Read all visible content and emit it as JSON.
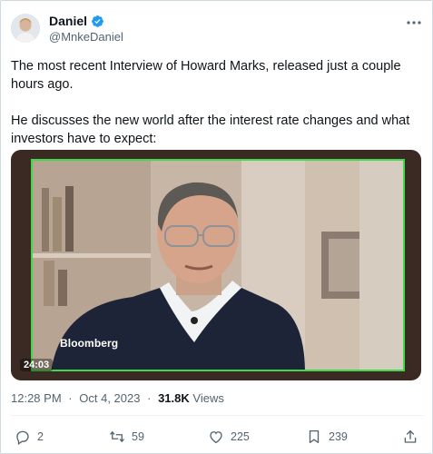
{
  "author": {
    "display_name": "Daniel",
    "handle": "@MnkeDaniel"
  },
  "tweet": {
    "paragraphs": [
      "The most recent Interview of Howard Marks, released just a couple hours ago.",
      "He discusses the new world after the interest rate changes and what investors have to expect:"
    ]
  },
  "media": {
    "brand_label": "Bloomberg",
    "duration": "24:03"
  },
  "meta": {
    "time": "12:28 PM",
    "date": "Oct 4, 2023",
    "views_count": "31.8K",
    "views_label": "Views",
    "separator": "·"
  },
  "actions": {
    "replies": "2",
    "reposts": "59",
    "likes": "225",
    "bookmarks": "239"
  },
  "colors": {
    "verified_blue": "#1d9bf0",
    "border_highlight": "#3fd94a",
    "secondary_text": "#536471"
  },
  "icons": [
    "verified-badge-icon",
    "more-icon",
    "reply-icon",
    "repost-icon",
    "like-icon",
    "bookmark-icon",
    "share-icon"
  ]
}
